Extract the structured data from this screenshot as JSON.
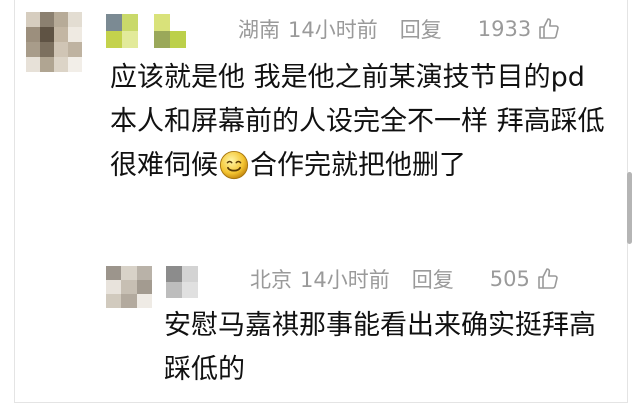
{
  "comment": {
    "location": "湖南",
    "time": "14小时前",
    "reply_label": "回复",
    "likes": "1933",
    "text_1": "应该就是他 我是他之前某演技节目的pd 本人和屏幕前的人设完全不一样 拜高踩低很难伺候",
    "text_2": "合作完就把他删了",
    "emoji": "smile-emoji"
  },
  "reply": {
    "location": "北京",
    "time": "14小时前",
    "reply_label": "回复",
    "likes": "505",
    "text": "安慰马嘉祺那事能看出来确实挺拜高踩低的"
  },
  "mosaics": {
    "avatar_main": [
      "#d6cdbf",
      "#8b8070",
      "#b7ab98",
      "#e3ddd2",
      "#9c8f7d",
      "#5f5344",
      "#c3b6a3",
      "#efeae2",
      "#a89c8a",
      "#7c705f",
      "#d0c5b5",
      "#bfb3a1",
      "#e7e1d8",
      "#b0a592",
      "#dcd4c7",
      "#f2eee8"
    ],
    "name_main": [
      "#7b8a93",
      "#c9d96a",
      "#ffffff",
      "#d9e27a",
      "#ffffff",
      "#c4d24c",
      "#e2ea9a",
      "#ffffff",
      "#9aa85a",
      "#bcd04a"
    ],
    "avatar_reply": [
      "#9c958c",
      "#d8d2c8",
      "#b9b2a8",
      "#e8e3dc",
      "#c7bfb3",
      "#a39b90",
      "#d1cabe",
      "#b3aa9e",
      "#efebe5"
    ],
    "name_reply": [
      "#8c8c8c",
      "#d3d3d3",
      "#bdbdbd",
      "#e0e0e0"
    ]
  },
  "colors": {
    "meta_text": "#9a9a9a",
    "body_text": "#111111",
    "scrollbar": "#b5b5b5"
  },
  "icons": {
    "like": "thumb-up-icon"
  }
}
